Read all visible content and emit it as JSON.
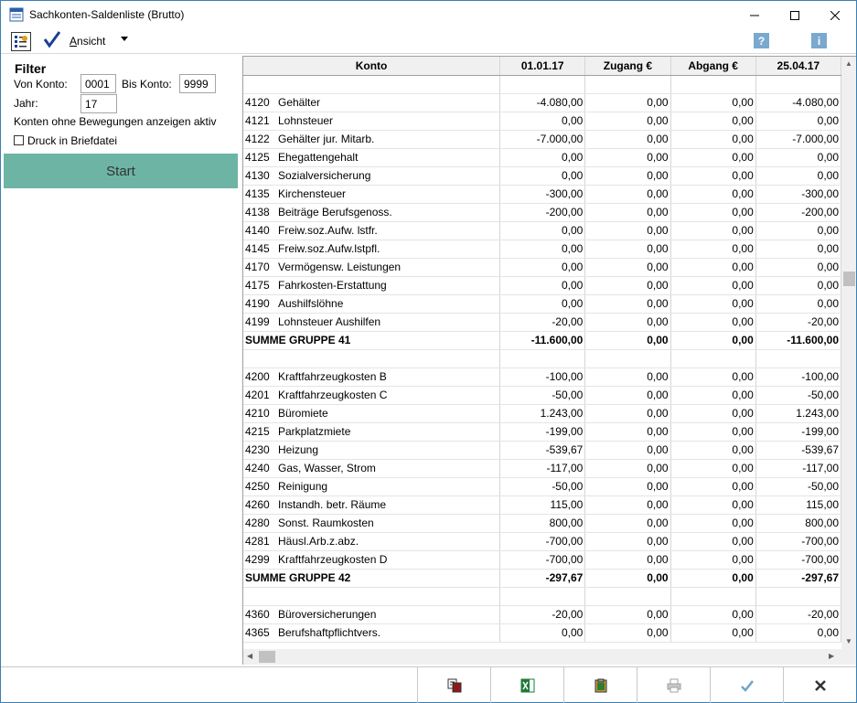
{
  "window": {
    "title": "Sachkonten-Saldenliste (Brutto)",
    "app_icon_text": "FIBU",
    "minimize": "—",
    "maximize": "☐",
    "close": "✕"
  },
  "toolbar": {
    "view_menu": "Ansicht",
    "view_menu_accesskey": "A",
    "view_menu_rest": "nsicht",
    "help": "?",
    "info": "i"
  },
  "filter": {
    "title": "Filter",
    "from_label": "Von Konto:",
    "from_value": "0001",
    "to_label": "Bis Konto:",
    "to_value": "9999",
    "year_label": "Jahr:",
    "year_value": "17",
    "show_inactive_text": "Konten ohne Bewegungen anzeigen aktiv",
    "print_to_file_label": "Druck in Briefdatei",
    "print_to_file_checked": false,
    "start_label": "Start"
  },
  "grid": {
    "headers": [
      "Konto",
      "01.01.17",
      "Zugang  €",
      "Abgang  €",
      "25.04.17"
    ],
    "rows": [
      {
        "type": "blank"
      },
      {
        "type": "data",
        "nr": "4120",
        "name": "Gehälter",
        "v": [
          "-4.080,00",
          "0,00",
          "0,00",
          "-4.080,00"
        ]
      },
      {
        "type": "data",
        "nr": "4121",
        "name": "Lohnsteuer",
        "v": [
          "0,00",
          "0,00",
          "0,00",
          "0,00"
        ]
      },
      {
        "type": "data",
        "nr": "4122",
        "name": "Gehälter jur. Mitarb.",
        "v": [
          "-7.000,00",
          "0,00",
          "0,00",
          "-7.000,00"
        ]
      },
      {
        "type": "data",
        "nr": "4125",
        "name": "Ehegattengehalt",
        "v": [
          "0,00",
          "0,00",
          "0,00",
          "0,00"
        ]
      },
      {
        "type": "data",
        "nr": "4130",
        "name": "Sozialversicherung",
        "v": [
          "0,00",
          "0,00",
          "0,00",
          "0,00"
        ]
      },
      {
        "type": "data",
        "nr": "4135",
        "name": "Kirchensteuer",
        "v": [
          "-300,00",
          "0,00",
          "0,00",
          "-300,00"
        ]
      },
      {
        "type": "data",
        "nr": "4138",
        "name": "Beiträge Berufsgenoss.",
        "v": [
          "-200,00",
          "0,00",
          "0,00",
          "-200,00"
        ]
      },
      {
        "type": "data",
        "nr": "4140",
        "name": "Freiw.soz.Aufw. lstfr.",
        "v": [
          "0,00",
          "0,00",
          "0,00",
          "0,00"
        ]
      },
      {
        "type": "data",
        "nr": "4145",
        "name": "Freiw.soz.Aufw.lstpfl.",
        "v": [
          "0,00",
          "0,00",
          "0,00",
          "0,00"
        ]
      },
      {
        "type": "data",
        "nr": "4170",
        "name": "Vermögensw. Leistungen",
        "v": [
          "0,00",
          "0,00",
          "0,00",
          "0,00"
        ]
      },
      {
        "type": "data",
        "nr": "4175",
        "name": "Fahrkosten-Erstattung",
        "v": [
          "0,00",
          "0,00",
          "0,00",
          "0,00"
        ]
      },
      {
        "type": "data",
        "nr": "4190",
        "name": "Aushilfslöhne",
        "v": [
          "0,00",
          "0,00",
          "0,00",
          "0,00"
        ]
      },
      {
        "type": "data",
        "nr": "4199",
        "name": "Lohnsteuer Aushilfen",
        "v": [
          "-20,00",
          "0,00",
          "0,00",
          "-20,00"
        ]
      },
      {
        "type": "sum",
        "label": "SUMME GRUPPE 41",
        "v": [
          "-11.600,00",
          "0,00",
          "0,00",
          "-11.600,00"
        ]
      },
      {
        "type": "blank"
      },
      {
        "type": "data",
        "nr": "4200",
        "name": "Kraftfahrzeugkosten B",
        "v": [
          "-100,00",
          "0,00",
          "0,00",
          "-100,00"
        ]
      },
      {
        "type": "data",
        "nr": "4201",
        "name": "Kraftfahrzeugkosten C",
        "v": [
          "-50,00",
          "0,00",
          "0,00",
          "-50,00"
        ]
      },
      {
        "type": "data",
        "nr": "4210",
        "name": "Büromiete",
        "v": [
          "1.243,00",
          "0,00",
          "0,00",
          "1.243,00"
        ]
      },
      {
        "type": "data",
        "nr": "4215",
        "name": "Parkplatzmiete",
        "v": [
          "-199,00",
          "0,00",
          "0,00",
          "-199,00"
        ]
      },
      {
        "type": "data",
        "nr": "4230",
        "name": "Heizung",
        "v": [
          "-539,67",
          "0,00",
          "0,00",
          "-539,67"
        ]
      },
      {
        "type": "data",
        "nr": "4240",
        "name": "Gas, Wasser, Strom",
        "v": [
          "-117,00",
          "0,00",
          "0,00",
          "-117,00"
        ]
      },
      {
        "type": "data",
        "nr": "4250",
        "name": "Reinigung",
        "v": [
          "-50,00",
          "0,00",
          "0,00",
          "-50,00"
        ]
      },
      {
        "type": "data",
        "nr": "4260",
        "name": "Instandh. betr. Räume",
        "v": [
          "115,00",
          "0,00",
          "0,00",
          "115,00"
        ]
      },
      {
        "type": "data",
        "nr": "4280",
        "name": "Sonst. Raumkosten",
        "v": [
          "800,00",
          "0,00",
          "0,00",
          "800,00"
        ]
      },
      {
        "type": "data",
        "nr": "4281",
        "name": "Häusl.Arb.z.abz.",
        "v": [
          "-700,00",
          "0,00",
          "0,00",
          "-700,00"
        ]
      },
      {
        "type": "data",
        "nr": "4299",
        "name": "Kraftfahrzeugkosten D",
        "v": [
          "-700,00",
          "0,00",
          "0,00",
          "-700,00"
        ]
      },
      {
        "type": "sum",
        "label": "SUMME GRUPPE 42",
        "v": [
          "-297,67",
          "0,00",
          "0,00",
          "-297,67"
        ]
      },
      {
        "type": "blank"
      },
      {
        "type": "data",
        "nr": "4360",
        "name": "Büroversicherungen",
        "v": [
          "-20,00",
          "0,00",
          "0,00",
          "-20,00"
        ]
      },
      {
        "type": "data",
        "nr": "4365",
        "name": "Berufshaftpflichtvers.",
        "v": [
          "0,00",
          "0,00",
          "0,00",
          "0,00"
        ]
      }
    ]
  },
  "bottom_buttons": [
    {
      "name": "copy-button",
      "icon": "copy-icon",
      "color": "#8b1a1a"
    },
    {
      "name": "excel-export-button",
      "icon": "excel-icon",
      "color": "#1e7a35"
    },
    {
      "name": "clipboard-button",
      "icon": "clipboard-icon",
      "color": "#2e7d32"
    },
    {
      "name": "print-button",
      "icon": "printer-icon",
      "color": "#a0a0a0"
    },
    {
      "name": "ok-button",
      "icon": "checkmark-icon",
      "color": "#6aa7c9"
    },
    {
      "name": "cancel-button",
      "icon": "x-icon",
      "color": "#333333"
    }
  ],
  "colors": {
    "start_button": "#6db4a5",
    "help_icon_bg": "#7aa8cf",
    "check_icon": "#1c3f9a"
  }
}
